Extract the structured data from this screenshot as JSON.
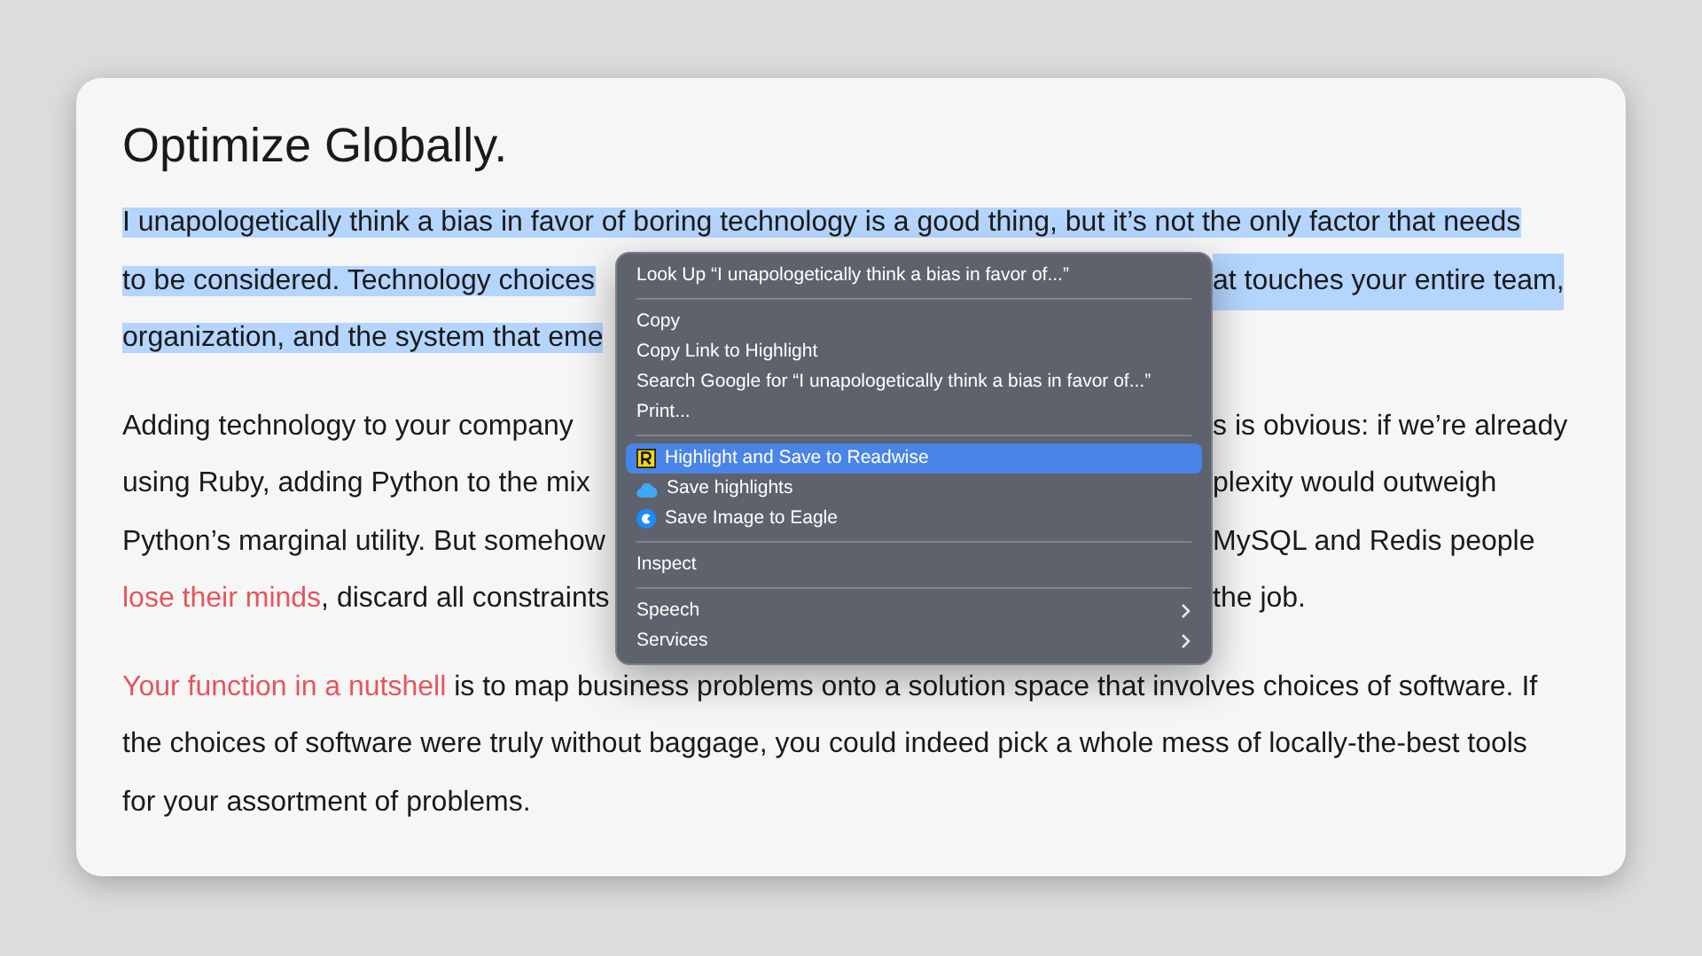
{
  "article": {
    "title": "Optimize Globally.",
    "paragraphs": [
      {
        "selected": true,
        "lines": [
          {
            "left": [
              {
                "kind": "text",
                "text": "I unapologetically think a bias in favor of boring technology is a good thing, but it’s not the only factor that needs"
              }
            ]
          },
          {
            "left": [
              {
                "kind": "text",
                "text": "to be considered. Technology choices"
              }
            ],
            "right": "at touches your entire team,"
          },
          {
            "left": [
              {
                "kind": "text",
                "text": "organization, and the system that eme"
              }
            ]
          }
        ]
      },
      {
        "selected": false,
        "lines": [
          {
            "left": [
              {
                "kind": "text",
                "text": "Adding technology to your company"
              }
            ],
            "right": "s is obvious: if we’re already"
          },
          {
            "left": [
              {
                "kind": "text",
                "text": "using Ruby, adding Python to the mix"
              }
            ],
            "right": "plexity would outweigh"
          },
          {
            "left": [
              {
                "kind": "text",
                "text": "Python’s marginal utility. But somehow"
              }
            ],
            "right": "MySQL and Redis people"
          },
          {
            "left": [
              {
                "kind": "link",
                "text": "lose their minds"
              },
              {
                "kind": "text",
                "text": ", discard all constraints"
              }
            ],
            "right": "the job."
          }
        ]
      },
      {
        "selected": false,
        "lines": [
          {
            "left": [
              {
                "kind": "link",
                "text": "Your function in a nutshell"
              },
              {
                "kind": "text",
                "text": " is to map business problems onto a solution space that involves choices of software. If"
              }
            ]
          },
          {
            "left": [
              {
                "kind": "text",
                "text": "the choices of software were truly without baggage, you could indeed pick a whole mess of locally-the-best tools"
              }
            ]
          },
          {
            "left": [
              {
                "kind": "text",
                "text": "for your assortment of problems."
              }
            ]
          }
        ]
      }
    ]
  },
  "context_menu": {
    "items": [
      {
        "kind": "item",
        "label": "Look Up “I unapologetically think a bias in favor of...”",
        "selected": false
      },
      {
        "kind": "separator"
      },
      {
        "kind": "item",
        "label": "Copy",
        "selected": false
      },
      {
        "kind": "item",
        "label": "Copy Link to Highlight",
        "selected": false
      },
      {
        "kind": "item",
        "label": "Search Google for “I unapologetically think a bias in favor of...”",
        "selected": false
      },
      {
        "kind": "item",
        "label": "Print...",
        "selected": false
      },
      {
        "kind": "separator"
      },
      {
        "kind": "extension",
        "label": "Highlight and Save to Readwise",
        "selected": true
      },
      {
        "kind": "extension",
        "label": "Save highlights",
        "selected": false
      },
      {
        "kind": "extension",
        "label": "Save Image to Eagle",
        "selected": false
      },
      {
        "kind": "separator"
      },
      {
        "kind": "item",
        "label": "Inspect",
        "selected": false
      },
      {
        "kind": "separator"
      },
      {
        "kind": "submenu",
        "label": "Speech",
        "selected": false
      },
      {
        "kind": "submenu",
        "label": "Services",
        "selected": false
      }
    ]
  }
}
